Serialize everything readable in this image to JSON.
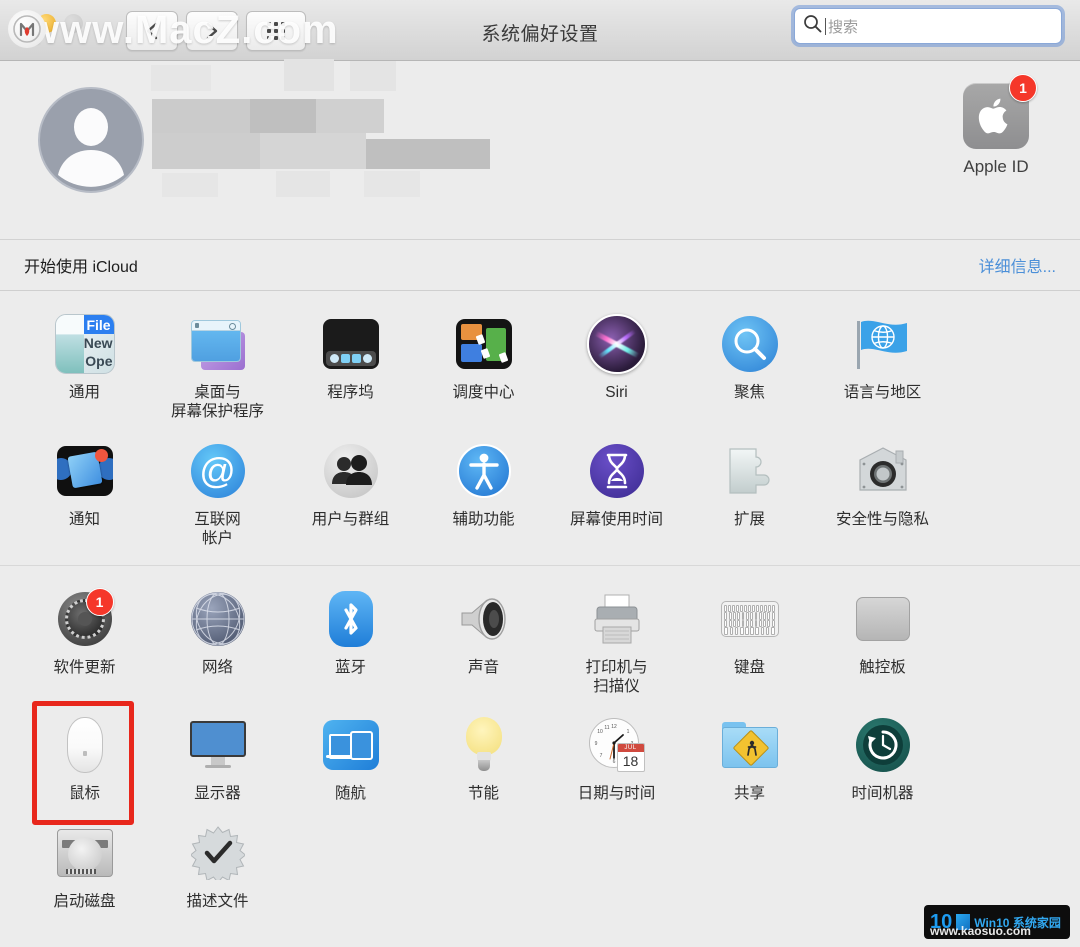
{
  "window": {
    "title": "系统偏好设置",
    "traffic_lights": [
      "close",
      "minimize",
      "zoom"
    ]
  },
  "toolbar": {
    "back_label": "后退",
    "forward_label": "前进",
    "show_all_label": "显示全部",
    "search_placeholder": "搜索",
    "search_value": ""
  },
  "banner": {
    "avatar_label": "用户头像",
    "name_redacted": true,
    "apple_id": {
      "label": "Apple ID",
      "badge": "1"
    }
  },
  "icloud_row": {
    "text": "开始使用 iCloud",
    "link": "详细信息..."
  },
  "sections": [
    {
      "name": "personal",
      "items": [
        {
          "label": "通用",
          "icon": "general-icon",
          "badge": null,
          "highlighted": false
        },
        {
          "label": "桌面与\n屏幕保护程序",
          "icon": "desktop-screensaver-icon",
          "badge": null,
          "highlighted": false
        },
        {
          "label": "程序坞",
          "icon": "dock-icon",
          "badge": null,
          "highlighted": false
        },
        {
          "label": "调度中心",
          "icon": "mission-control-icon",
          "badge": null,
          "highlighted": false
        },
        {
          "label": "Siri",
          "icon": "siri-icon",
          "badge": null,
          "highlighted": false
        },
        {
          "label": "聚焦",
          "icon": "spotlight-icon",
          "badge": null,
          "highlighted": false
        },
        {
          "label": "语言与地区",
          "icon": "language-region-icon",
          "badge": null,
          "highlighted": false
        },
        {
          "label": "通知",
          "icon": "notifications-icon",
          "badge": null,
          "highlighted": false
        },
        {
          "label": "互联网\n帐户",
          "icon": "internet-accounts-icon",
          "badge": null,
          "highlighted": false
        },
        {
          "label": "用户与群组",
          "icon": "users-groups-icon",
          "badge": null,
          "highlighted": false
        },
        {
          "label": "辅助功能",
          "icon": "accessibility-icon",
          "badge": null,
          "highlighted": false
        },
        {
          "label": "屏幕使用时间",
          "icon": "screen-time-icon",
          "badge": null,
          "highlighted": false
        },
        {
          "label": "扩展",
          "icon": "extensions-icon",
          "badge": null,
          "highlighted": false
        },
        {
          "label": "安全性与隐私",
          "icon": "security-privacy-icon",
          "badge": null,
          "highlighted": false
        }
      ]
    },
    {
      "name": "hardware",
      "items": [
        {
          "label": "软件更新",
          "icon": "software-update-icon",
          "badge": "1",
          "highlighted": false
        },
        {
          "label": "网络",
          "icon": "network-icon",
          "badge": null,
          "highlighted": false
        },
        {
          "label": "蓝牙",
          "icon": "bluetooth-icon",
          "badge": null,
          "highlighted": false
        },
        {
          "label": "声音",
          "icon": "sound-icon",
          "badge": null,
          "highlighted": false
        },
        {
          "label": "打印机与\n扫描仪",
          "icon": "printers-scanners-icon",
          "badge": null,
          "highlighted": false
        },
        {
          "label": "键盘",
          "icon": "keyboard-icon",
          "badge": null,
          "highlighted": false
        },
        {
          "label": "触控板",
          "icon": "trackpad-icon",
          "badge": null,
          "highlighted": false
        },
        {
          "label": "鼠标",
          "icon": "mouse-icon",
          "badge": null,
          "highlighted": true
        },
        {
          "label": "显示器",
          "icon": "displays-icon",
          "badge": null,
          "highlighted": false
        },
        {
          "label": "随航",
          "icon": "sidecar-icon",
          "badge": null,
          "highlighted": false
        },
        {
          "label": "节能",
          "icon": "energy-saver-icon",
          "badge": null,
          "highlighted": false
        },
        {
          "label": "日期与时间",
          "icon": "date-time-icon",
          "badge": null,
          "highlighted": false
        },
        {
          "label": "共享",
          "icon": "sharing-icon",
          "badge": null,
          "highlighted": false
        },
        {
          "label": "时间机器",
          "icon": "time-machine-icon",
          "badge": null,
          "highlighted": false
        },
        {
          "label": "启动磁盘",
          "icon": "startup-disk-icon",
          "badge": null,
          "highlighted": false
        },
        {
          "label": "描述文件",
          "icon": "profiles-icon",
          "badge": null,
          "highlighted": false
        }
      ]
    }
  ],
  "date_time_icon": {
    "month": "JUL",
    "day": "18"
  },
  "watermarks": {
    "top_text": "www.MacZ.com",
    "bottom_brand": "Win10 系统家园",
    "bottom_badge": "10",
    "bottom_url": "www.kaosuo.com"
  },
  "colors": {
    "accent_blue": "#4b8fd8",
    "badge_red": "#f5372a",
    "highlight_red": "#e8271c",
    "window_bg": "#ececec"
  }
}
